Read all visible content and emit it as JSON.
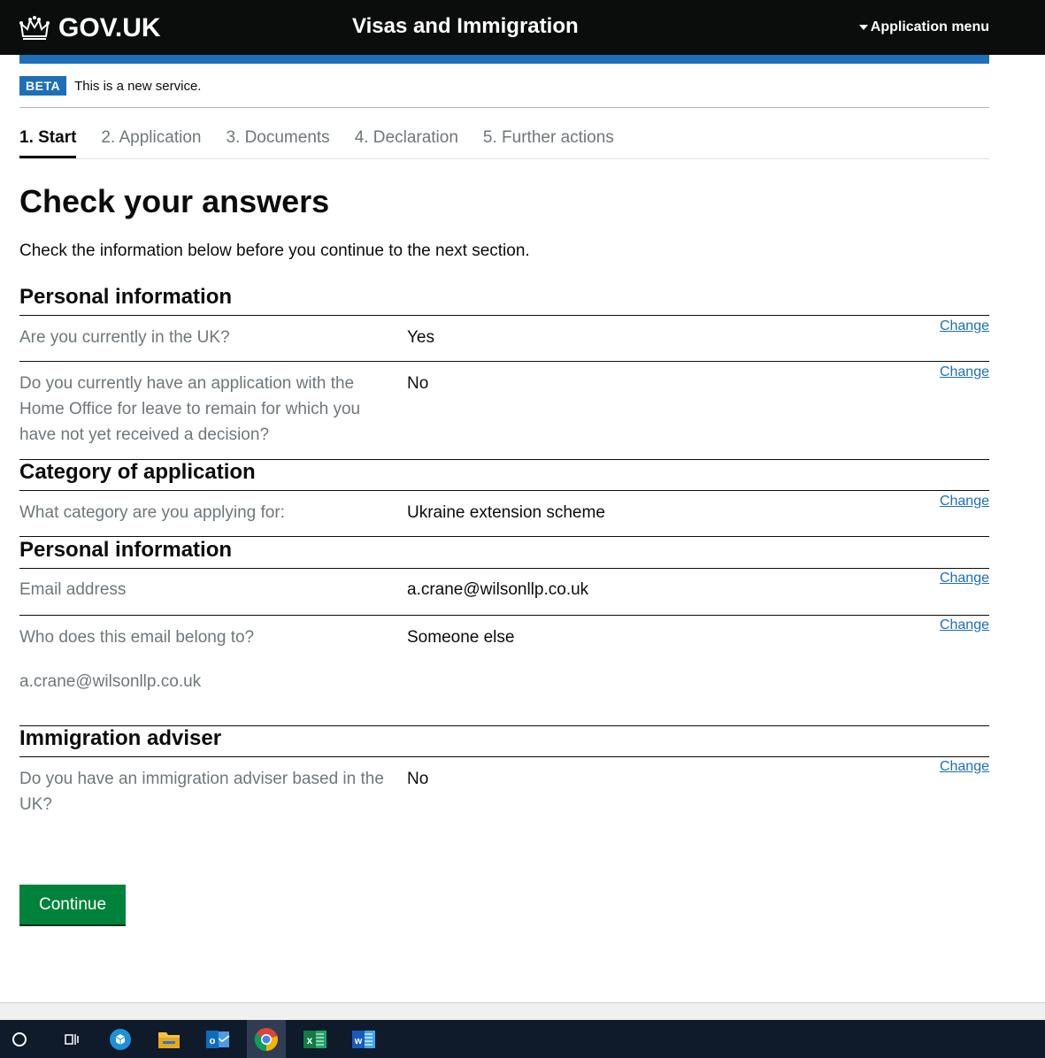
{
  "header": {
    "logo_text": "GOV.UK",
    "service_name": "Visas and Immigration",
    "menu_label": "Application menu"
  },
  "beta": {
    "tag": "BETA",
    "text": "This is a new service."
  },
  "steps": [
    {
      "label": "1. Start",
      "active": true
    },
    {
      "label": "2. Application",
      "active": false
    },
    {
      "label": "3. Documents",
      "active": false
    },
    {
      "label": "4. Declaration",
      "active": false
    },
    {
      "label": "5. Further actions",
      "active": false
    }
  ],
  "page": {
    "title": "Check your answers",
    "intro": "Check the information below before you continue to the next section."
  },
  "sections": [
    {
      "heading": "Personal information",
      "rows": [
        {
          "question": "Are you currently in the UK?",
          "answer": "Yes",
          "action": "Change"
        },
        {
          "question": "Do you currently have an application with the Home Office for leave to remain for which you have not yet received a decision?",
          "answer": "No",
          "action": "Change"
        }
      ]
    },
    {
      "heading": "Category of application",
      "rows": [
        {
          "question": "What category are you applying for:",
          "answer": "Ukraine extension scheme",
          "action": "Change"
        }
      ]
    },
    {
      "heading": "Personal information",
      "rows": [
        {
          "question": "Email address",
          "answer": "a.crane@wilsonllp.co.uk",
          "action": "Change"
        },
        {
          "question": "Who does this email belong to?",
          "answer": "Someone else",
          "action": "Change",
          "extra": "a.crane@wilsonllp.co.uk"
        }
      ]
    },
    {
      "heading": "Immigration adviser",
      "rows": [
        {
          "question": "Do you have an immigration adviser based in the UK?",
          "answer": "No",
          "action": "Change"
        }
      ]
    }
  ],
  "continue_label": "Continue",
  "taskbar": {
    "icons": [
      "search-icon",
      "task-view-icon",
      "app-icon",
      "file-explorer-icon",
      "outlook-icon",
      "chrome-icon",
      "excel-icon",
      "word-icon"
    ]
  },
  "colors": {
    "brand_blue": "#1d70b8",
    "button_green": "#00823b",
    "header_black": "#0b0c0c",
    "link": "#1d70b8",
    "secondary_text": "#6f777b"
  }
}
